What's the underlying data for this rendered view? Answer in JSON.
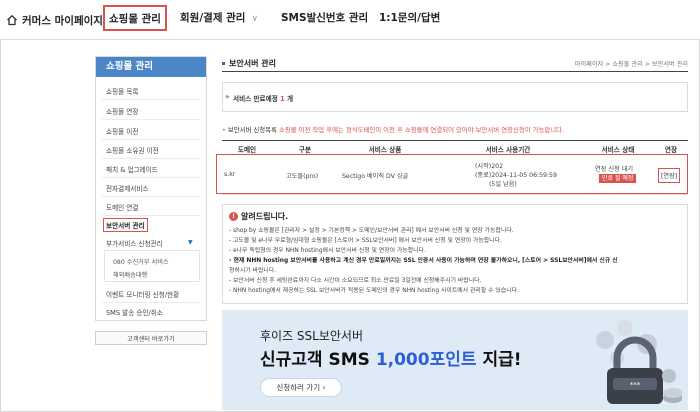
{
  "topnav": {
    "home_label": "커머스 마이페이지",
    "items": [
      "쇼핑몰 관리",
      "회원/결제 관리",
      "SMS발신번호 관리",
      "1:1문의/답변"
    ]
  },
  "sidebar": {
    "title": "쇼핑몰 관리",
    "items": [
      "쇼핑몰 목록",
      "쇼핑몰 연장",
      "쇼핑몰 이전",
      "쇼핑몰 소유권 이전",
      "패치 & 업그레이드",
      "전자결제서비스",
      "도메인 연결",
      "보안서버 관리",
      "부가서비스 신청관리"
    ],
    "sub_items": [
      "080 수신거부 서비스",
      "해외배송대행"
    ],
    "items_after": [
      "이벤트 모니터링 신청/현황",
      "SMS 발송 승인/취소"
    ],
    "cs_button": "고객센터 바로가기"
  },
  "main": {
    "title": "보안서버 관리",
    "breadcrumb": "마이페이지 > 쇼핑몰 관리 > 보안서버 관리",
    "notice": {
      "prefix": "서비스 만료예정",
      "count": "1",
      "suffix": "개"
    },
    "info_label": "보안서버 신청목록",
    "info_warning": "쇼핑몰 이전 작업 후에는 정식도메인이 이전 후 쇼핑몰에 연결되어 있어야 보안서버 연장신청이 가능합니다.",
    "table": {
      "headers": [
        "도메인",
        "구분",
        "서비스 상품",
        "서비스 사용기간",
        "서비스 상태",
        "연장"
      ],
      "row": {
        "domain": "s.kr",
        "type": "고도몰(pro)",
        "product": "Sectigo 베이직 DV 싱글",
        "period_start": "(시작)202",
        "period_end": "(종료)2024-11-05 06:59:59",
        "period_days": "(5일 남음)",
        "status": "연장 신청 대기",
        "status_tag": "만료 될 예정",
        "extend": "[연장]"
      }
    },
    "alert": {
      "title": "알려드립니다.",
      "lines": [
        "- shop by 쇼핑몰은 [관리자 > 설정 > 기본정책 > 도메인/보안서버 관리] 에서 보안서버 신청 및 연장 가능합니다.",
        "- 고도몰 및 e나무 무료형/임대형 쇼핑몰은 [스토어 > SSL보안서버] 에서 보안서버 신청 및 연장이 가능합니다.",
        "- e나무 독립형의 경우 NHN hosting에서 보안서버 신청 및 연장이 가능합니다.",
        "- 현재 NHN hosting 보안서버를 사용하고 계신 경우 만료일까지는 SSL 인증서 사용이 가능하며 연장 불가하오니, [스토어 > SSL보안서버]에서 신규 신",
        "청하시기 바랍니다.",
        "- 보안서버 신청 후 세팅완료까지 다소 시간이 소요되므로 최소 만료일 3일전에 신청해주시기 바랍니다.",
        "- NHN hosting에서 제공하는 SSL 보안서버가 적용된 도메인의 경우 NHN hosting 사이트에서 관리할 수 있습니다."
      ]
    },
    "banner": {
      "sub": "후이즈 SSL보안서버",
      "main_prefix": "신규고객 SMS",
      "main_highlight": "1,000포인트",
      "main_suffix": "지급!",
      "button": "신청하러 가기 ›"
    }
  },
  "colors": {
    "accent": "#d9534f",
    "sidebar_head": "#4a86c8",
    "banner_bg": "#dfeaf7",
    "banner_highlight": "#2c5fd6"
  }
}
